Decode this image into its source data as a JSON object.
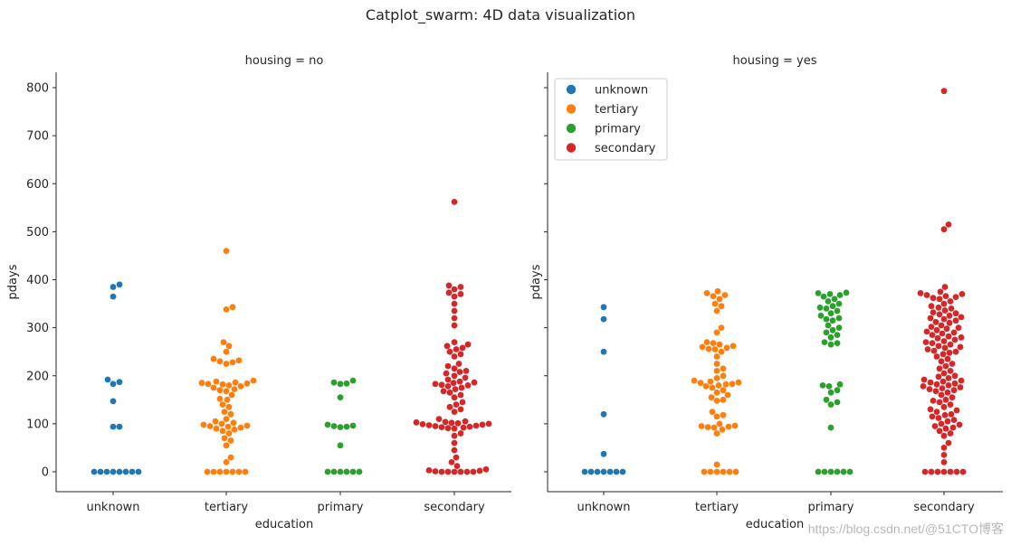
{
  "chart_data": {
    "type": "scatter",
    "subtype": "swarm",
    "title": "Catplot_swarm: 4D data visualization",
    "xlabel": "education",
    "ylabel": "pdays",
    "ylim": [
      -40,
      830
    ],
    "yticks": [
      0,
      100,
      200,
      300,
      400,
      500,
      600,
      700,
      800
    ],
    "categories": [
      "unknown",
      "tertiary",
      "primary",
      "secondary"
    ],
    "colors": {
      "unknown": "#1f77b4",
      "tertiary": "#ff7f0e",
      "primary": "#2ca02c",
      "secondary": "#d62728"
    },
    "legend": {
      "placement": "top-left",
      "facet": "housing = yes",
      "entries": [
        "unknown",
        "tertiary",
        "primary",
        "secondary"
      ]
    },
    "grid": false,
    "facets": [
      {
        "title": "housing = no",
        "series": {
          "unknown": [
            390,
            385,
            365,
            192,
            187,
            183,
            147,
            94,
            94,
            0,
            0,
            0,
            0,
            0,
            0,
            0,
            0
          ],
          "tertiary": [
            460,
            343,
            338,
            270,
            262,
            250,
            235,
            232,
            230,
            228,
            225,
            190,
            188,
            186,
            185,
            184,
            183,
            182,
            180,
            178,
            175,
            172,
            170,
            168,
            160,
            152,
            150,
            140,
            135,
            125,
            120,
            110,
            105,
            102,
            100,
            98,
            96,
            95,
            94,
            92,
            90,
            88,
            85,
            80,
            70,
            65,
            55,
            30,
            20,
            0,
            0,
            0,
            0,
            0,
            0,
            0
          ],
          "primary": [
            190,
            186,
            184,
            183,
            155,
            98,
            96,
            95,
            94,
            93,
            55,
            0,
            0,
            0,
            0,
            0,
            0
          ],
          "secondary": [
            562,
            388,
            385,
            380,
            373,
            370,
            365,
            350,
            335,
            320,
            305,
            270,
            265,
            262,
            258,
            255,
            250,
            245,
            240,
            225,
            220,
            215,
            210,
            208,
            205,
            200,
            196,
            192,
            188,
            186,
            185,
            183,
            181,
            180,
            178,
            175,
            172,
            168,
            165,
            160,
            155,
            145,
            140,
            135,
            130,
            125,
            110,
            105,
            104,
            103,
            102,
            101,
            100,
            99,
            98,
            97,
            96,
            95,
            94,
            93,
            92,
            91,
            90,
            80,
            75,
            60,
            45,
            30,
            20,
            12,
            5,
            3,
            2,
            1,
            0,
            0,
            0,
            0,
            0,
            0
          ]
        }
      },
      {
        "title": "housing = yes",
        "series": {
          "unknown": [
            343,
            318,
            250,
            120,
            37,
            0,
            0,
            0,
            0,
            0,
            0,
            0
          ],
          "tertiary": [
            376,
            372,
            368,
            366,
            360,
            350,
            345,
            335,
            300,
            290,
            270,
            268,
            265,
            262,
            260,
            258,
            256,
            255,
            250,
            240,
            225,
            215,
            210,
            200,
            195,
            190,
            188,
            186,
            185,
            183,
            182,
            180,
            178,
            175,
            170,
            165,
            160,
            155,
            150,
            148,
            125,
            118,
            115,
            100,
            96,
            95,
            94,
            93,
            92,
            88,
            80,
            15,
            0,
            0,
            0,
            0,
            0,
            0
          ],
          "primary": [
            373,
            372,
            370,
            368,
            365,
            360,
            355,
            350,
            345,
            342,
            340,
            335,
            330,
            325,
            320,
            318,
            315,
            305,
            300,
            295,
            290,
            285,
            280,
            270,
            268,
            265,
            182,
            180,
            178,
            170,
            165,
            150,
            145,
            140,
            92,
            0,
            0,
            0,
            0,
            0,
            0
          ],
          "secondary": [
            793,
            515,
            505,
            385,
            375,
            372,
            370,
            368,
            366,
            364,
            362,
            360,
            355,
            350,
            345,
            342,
            340,
            336,
            332,
            330,
            328,
            325,
            322,
            320,
            318,
            315,
            312,
            310,
            305,
            302,
            300,
            298,
            295,
            292,
            290,
            288,
            285,
            282,
            280,
            278,
            275,
            272,
            270,
            268,
            265,
            262,
            260,
            258,
            255,
            252,
            250,
            248,
            245,
            240,
            235,
            230,
            225,
            220,
            215,
            210,
            205,
            200,
            198,
            195,
            192,
            190,
            188,
            186,
            184,
            182,
            180,
            178,
            176,
            174,
            172,
            170,
            168,
            165,
            160,
            155,
            150,
            148,
            145,
            140,
            135,
            130,
            128,
            125,
            120,
            118,
            115,
            112,
            108,
            105,
            100,
            98,
            95,
            92,
            90,
            85,
            80,
            75,
            60,
            50,
            35,
            20,
            0,
            0,
            0,
            0,
            0,
            0,
            0
          ]
        }
      }
    ]
  },
  "watermark": "https://blog.csdn.net/@51CTO博客"
}
